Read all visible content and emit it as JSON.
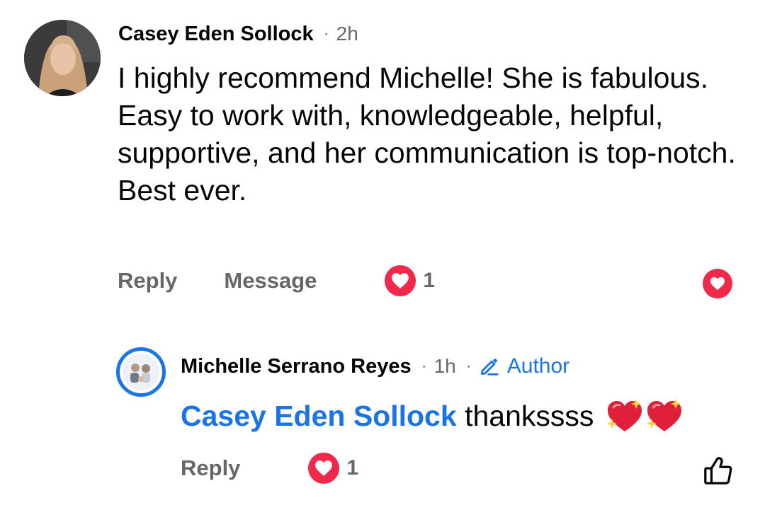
{
  "comment": {
    "author": "Casey Eden Sollock",
    "separator": "·",
    "time": "2h",
    "text": "I highly recommend Michelle! She is fabulous. Easy to work with, knowledgeable, helpful, supportive, and her communication is top-notch.  Best ever.",
    "actions": {
      "reply": "Reply",
      "message": "Message"
    },
    "reaction_count": "1",
    "reaction_icon": "heart-icon"
  },
  "reply": {
    "author": "Michelle Serrano Reyes",
    "separator": "·",
    "time": "1h",
    "separator2": "·",
    "badge": "Author",
    "mention": "Casey Eden Sollock",
    "text": "thankssss",
    "emojis": [
      "sparkling-heart-icon",
      "sparkling-heart-icon"
    ],
    "actions": {
      "reply": "Reply"
    },
    "reaction_count": "1",
    "like_icon": "thumbs-up-icon"
  },
  "colors": {
    "accent": "#1b74e4",
    "heart": "#f02849",
    "muted": "#65676b",
    "text": "#050505"
  }
}
